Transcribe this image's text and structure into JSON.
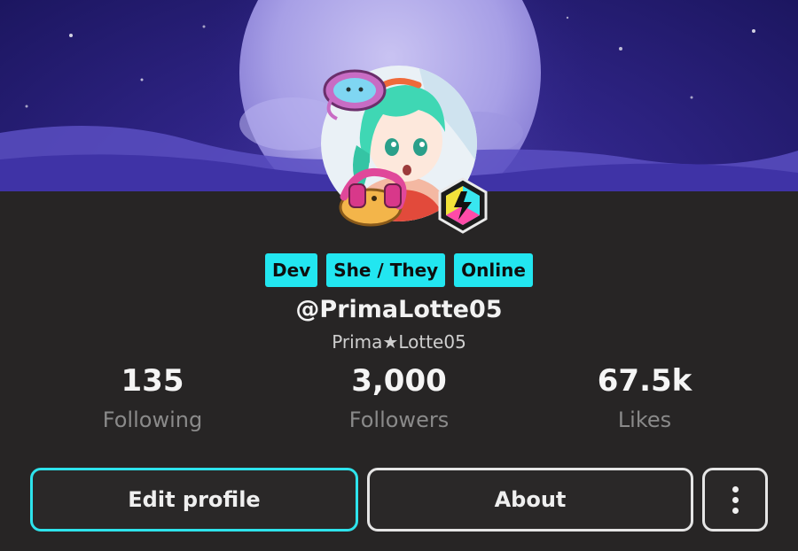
{
  "profile": {
    "tags": [
      "Dev",
      "She / They",
      "Online"
    ],
    "handle": "@PrimaLotte05",
    "display_name": "Prima★Lotte05"
  },
  "stats": {
    "following": {
      "value": "135",
      "label": "Following"
    },
    "followers": {
      "value": "3,000",
      "label": "Followers"
    },
    "likes": {
      "value": "67.5k",
      "label": "Likes"
    }
  },
  "actions": {
    "edit_label": "Edit profile",
    "about_label": "About",
    "more_icon": "more-vertical-icon"
  },
  "colors": {
    "accent": "#22e6f0",
    "background": "#272525",
    "banner": "#2f2486"
  }
}
